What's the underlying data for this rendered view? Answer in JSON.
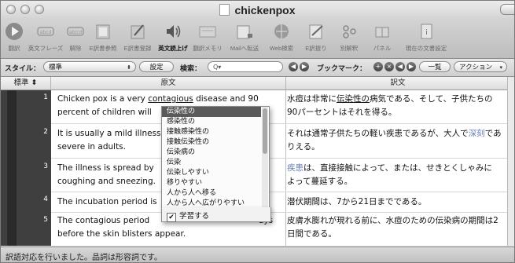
{
  "window": {
    "title": "chickenpox"
  },
  "toolbar": [
    {
      "label": "翻訳",
      "icon": "play-icon"
    },
    {
      "label": "英文フレーズ",
      "icon": "phrase-icon"
    },
    {
      "label": "解除",
      "icon": "unlink-icon"
    },
    {
      "label": "E訳書参照",
      "icon": "book-icon"
    },
    {
      "label": "E訳書登録",
      "icon": "register-icon"
    },
    {
      "label": "英文読上げ",
      "icon": "speaker-icon"
    },
    {
      "label": "翻訳メモリ",
      "icon": "memory-icon"
    },
    {
      "label": "Mailへ転送",
      "icon": "mail-icon"
    },
    {
      "label": "Web検索",
      "icon": "web-search-icon"
    },
    {
      "label": "E訳振り",
      "icon": "edit-icon"
    },
    {
      "label": "別解釈",
      "icon": "alternate-icon"
    },
    {
      "label": "パネル",
      "icon": "panel-icon"
    },
    {
      "label": "現在の文書設定",
      "icon": "document-settings-icon"
    }
  ],
  "stylebar": {
    "style_label": "スタイル：",
    "style_value": "標準",
    "settings_button": "設定",
    "search_label": "検索：",
    "search_placeholder": "Q",
    "bookmark_label": "ブックマーク：",
    "list_button": "一覧",
    "action_button": "アクション"
  },
  "table": {
    "col_style": "標準",
    "col_source": "原文",
    "col_translation": "訳文",
    "rows": [
      {
        "num": "1",
        "src_pre": "Chicken pox is a very ",
        "src_ul": "contagious",
        "src_post": " disease and 90",
        "src2": "percent of children will",
        "tr_pre": "水痘は非常に",
        "tr_ul": "伝染性の",
        "tr_post": "病気である、そして、子供たちの",
        "tr2": "90パーセントはそれを得る。"
      },
      {
        "num": "2",
        "src": "It is usually a mild illness",
        "src2": "severe in adults.",
        "tr_pre": "それは通常子供たちの軽い疾患であるが、大人で",
        "tr_hl": "深刻",
        "tr_post": "であ",
        "tr2": "りえる。"
      },
      {
        "num": "3",
        "src": "The illness is spread by",
        "src2": "coughing and sneezing.",
        "tr_hl": "疾患",
        "tr_post": "は、直接接触によって、または、せきとくしゃみに",
        "tr2": "よって蔓延する。"
      },
      {
        "num": "4",
        "src": "The incubation period is",
        "tr": "潜伏期間は、7から21日までである。"
      },
      {
        "num": "5",
        "src": "The contagious period",
        "src_right": "ays",
        "src2": "before the skin blisters appear.",
        "tr": "皮膚水膨れが現れる前に、水痘のための伝染病の期間は2",
        "tr2": "日間である。"
      }
    ]
  },
  "dropdown": {
    "items": [
      "伝染性の",
      "感染性の",
      "接触感染性の",
      "接触伝染性の",
      "伝染病の",
      "伝染",
      "伝染しやすい",
      "移りやすい",
      "人から人へ移る",
      "人から人へ広がりやすい"
    ],
    "selected": "伝染性の",
    "learn_label": "学習する",
    "learn_checked": true
  },
  "status": "訳語対応を行いました。品詞は形容詞です。"
}
